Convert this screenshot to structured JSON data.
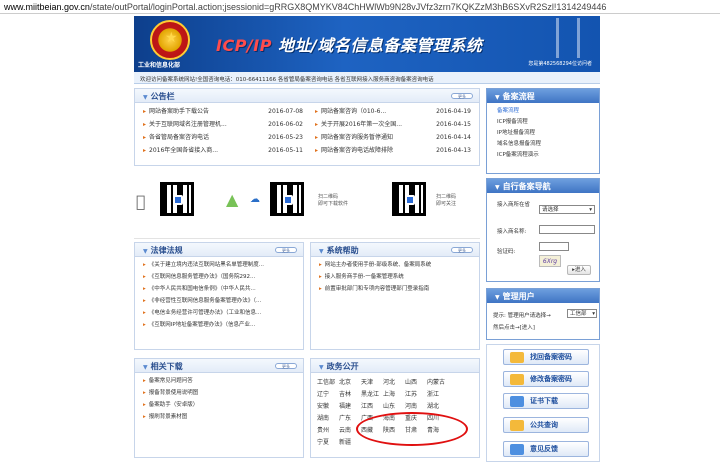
{
  "url": {
    "host": "www.miitbeian.gov.cn",
    "path": "/state/outPortal/loginPortal.action;jsessionid=gRRGX8QMYKV84ChHWlWb9N28vJVfz3zrn7KQKZzM3hB6SXvR2Szl!1314249446"
  },
  "banner": {
    "title_part1": "ICP/IP",
    "title_part2": " 地址/域名信息备案管理系统",
    "small_text": "工业和信息化部",
    "right_text": "您是第482568294位访问者"
  },
  "ticker": "欢迎访问备案系统网站!全国咨询电话：010-66411166 各省管局备案咨询电话 各省互联网接入服务商咨询备案咨询电话",
  "notice": {
    "title": "公告栏",
    "more": "更多",
    "left": [
      {
        "text": "网站备案助手下载公告",
        "date": "2016-07-08"
      },
      {
        "text": "关于互联网域名注册管理机...",
        "date": "2016-06-02"
      },
      {
        "text": "各省管局备案咨询电话",
        "date": "2016-05-23"
      },
      {
        "text": "2016年全国各省接入商...",
        "date": "2016-05-11"
      }
    ],
    "right": [
      {
        "text": "网站备案咨询（010-6...",
        "date": "2016-04-19"
      },
      {
        "text": "关于开展2016年第一次全国...",
        "date": "2016-04-15"
      },
      {
        "text": "网站备案咨询服务暂停通知",
        "date": "2016-04-14"
      },
      {
        "text": "网站备案咨询电话故障排除",
        "date": "2016-04-13"
      }
    ]
  },
  "apps": {
    "label1": "扫二维码\n即可下载软件",
    "label2": "扫二维码\n即可关注"
  },
  "law": {
    "title": "法律法规",
    "more": "更多",
    "items": [
      "《关于建立境内违法互联网站黑名单管理制度...",
      "《互联网信息服务管理办法》（国务院292...",
      "《中华人民共和国电信条例》（中华人民共...",
      "《非经营性互联网信息服务备案管理办法》（...",
      "《电信业务经营许可管理办法》（工业和信息...",
      "《互联网IP地址备案管理办法》（信息产业..."
    ]
  },
  "help": {
    "title": "系统帮助",
    "more": "更多",
    "items": [
      "网站主办者使用手册-部级系统、备案局系统",
      "接入服务商手册-一备案管理系统",
      "前置审批部门和专项内容管理部门登录指南"
    ]
  },
  "downloads": {
    "title": "相关下载",
    "more": "更多",
    "items": [
      "备案常见问题问答",
      "报备背景使用说明图",
      "备案助手（安卓版）",
      "报刷背景素材图"
    ]
  },
  "gov": {
    "title": "政务公开",
    "provinces": [
      "工信部",
      "北京",
      "天津",
      "河北",
      "山西",
      "内蒙古",
      "辽宁",
      "吉林",
      "黑龙江",
      "上海",
      "江苏",
      "浙江",
      "安徽",
      "福建",
      "江西",
      "山东",
      "河南",
      "湖北",
      "湖南",
      "广东",
      "广西",
      "海南",
      "重庆",
      "四川",
      "贵州",
      "云南",
      "西藏",
      "陕西",
      "甘肃",
      "青海",
      "宁夏",
      "新疆"
    ]
  },
  "process": {
    "title": "备案流程",
    "items": [
      "备案流程",
      "ICP报备流程",
      "IP地址报备流程",
      "域名信息报备流程",
      "ICP备案流程演示"
    ]
  },
  "self_nav": {
    "title": "自行备案导航",
    "province_label": "接入商所在省",
    "province_value": "请选择",
    "name_label": "接入商名称:",
    "captcha_label": "验证码:",
    "captcha_text": "6Xrg",
    "enter_label": "进入"
  },
  "admin": {
    "title": "管理用户",
    "hint": "提示: 管理用户请选择→",
    "select_value": "工信部",
    "hint2": "然后点击→",
    "enter_label": "[进入]"
  },
  "services": [
    {
      "label": "找回备案密码"
    },
    {
      "label": "修改备案密码"
    },
    {
      "label": "证书下载"
    },
    {
      "label": "公共查询"
    },
    {
      "label": "意见反馈"
    }
  ]
}
